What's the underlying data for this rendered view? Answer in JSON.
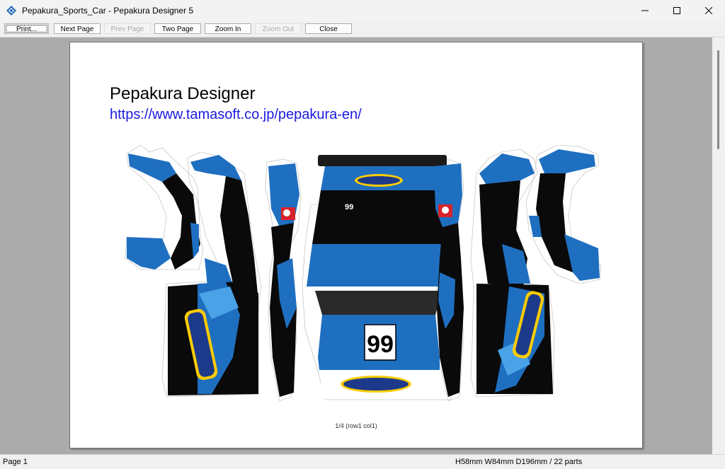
{
  "window": {
    "title": "Pepakura_Sports_Car - Pepakura Designer 5",
    "icon": "pepakura-app-icon",
    "controls": [
      "minimize-icon",
      "maximize-icon",
      "close-icon"
    ]
  },
  "toolbar": {
    "print": "Print...",
    "next_page": "Next Page",
    "prev_page": "Prev Page",
    "two_page": "Two Page",
    "zoom_in": "Zoom In",
    "zoom_out": "Zoom Out",
    "close": "Close"
  },
  "page": {
    "title": "Pepakura Designer",
    "url": "https://www.tamasoft.co.jp/pepakura-en/",
    "footer": "1/4 (row1 col1)",
    "part_labels": {
      "number_small": "99",
      "number_large": "99"
    }
  },
  "status": {
    "left": "Page 1",
    "right": "H58mm W84mm D196mm / 22 parts"
  },
  "colors": {
    "body_blue": "#1f6fc1",
    "dark": "#0a0a0a",
    "url_blue": "#1a1adf",
    "viewport_gray": "#ababab"
  }
}
